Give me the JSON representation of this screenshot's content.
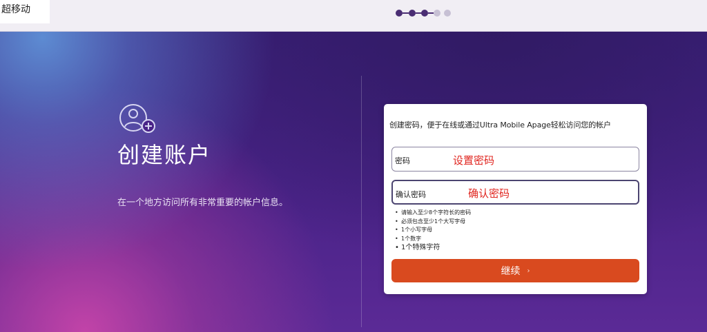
{
  "header": {
    "brand": "超移动",
    "stepper": {
      "total_steps": 5,
      "current_step": 3
    }
  },
  "hero": {
    "title": "创建账户",
    "subtitle": "在一个地方访问所有非常重要的帐户信息。",
    "icon": "add-user-icon"
  },
  "form": {
    "intro": "创建密码，便于在线或通过Ultra Mobile Apage轻松访问您的帐户",
    "password": {
      "label": "密码",
      "value": "设置密码"
    },
    "confirm": {
      "label": "确认密码",
      "value": "确认密码"
    },
    "requirements": [
      "请输入至少8个字符长的密码",
      "必须包含至少1个大写字母",
      "1个小写字母",
      "1个数字",
      "1个特殊字符"
    ],
    "continue_label": "继续"
  },
  "colors": {
    "accent": "#d94a1f",
    "brand_purple": "#4a2d73",
    "annotation_red": "#e0251f"
  }
}
